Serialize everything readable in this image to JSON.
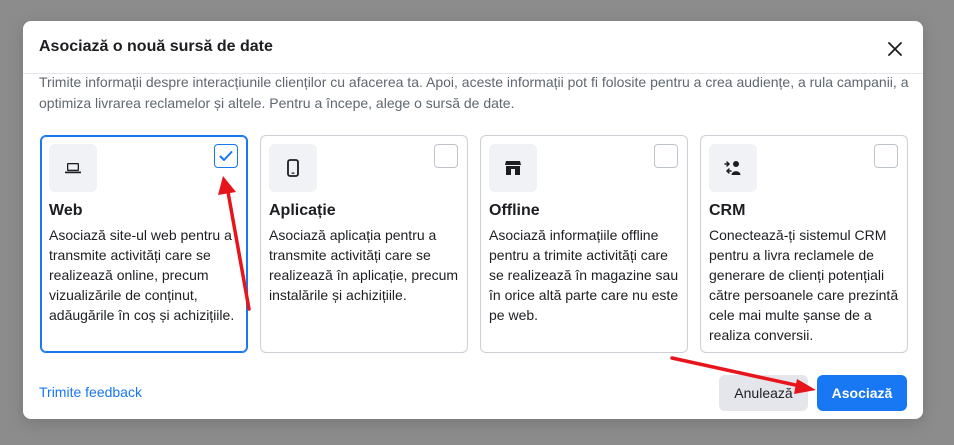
{
  "dialog": {
    "title": "Asociază o nouă sursă de date",
    "description": "Trimite informații despre interacțiunile clienților cu afacerea ta. Apoi, aceste informații pot fi folosite pentru a crea audiențe, a rula campanii, a optimiza livrarea reclamelor și altele. Pentru a începe, alege o sursă de date.",
    "close_icon": "close-icon"
  },
  "sources": [
    {
      "icon": "laptop-icon",
      "title": "Web",
      "description": "Asociază site-ul web pentru a transmite activități care se realizează online, precum vizualizările de conținut, adăugările în coș și achizițiile.",
      "selected": true
    },
    {
      "icon": "phone-icon",
      "title": "Aplicație",
      "description": "Asociază aplicația pentru a transmite activități care se realizează în aplicație, precum instalările și achizițiile.",
      "selected": false
    },
    {
      "icon": "store-icon",
      "title": "Offline",
      "description": "Asociază informațiile offline pentru a trimite activități care se realizează în magazine sau în orice altă parte care nu este pe web.",
      "selected": false
    },
    {
      "icon": "crm-icon",
      "title": "CRM",
      "description": "Conectează-ți sistemul CRM pentru a livra reclamele de generare de clienți potențiali către persoanele care prezintă cele mai multe șanse de a realiza conversii.",
      "selected": false
    }
  ],
  "footer": {
    "feedback_label": "Trimite feedback",
    "cancel_label": "Anulează",
    "confirm_label": "Asociază"
  },
  "colors": {
    "accent": "#1877f2",
    "annotation_arrow": "#e8141b"
  }
}
